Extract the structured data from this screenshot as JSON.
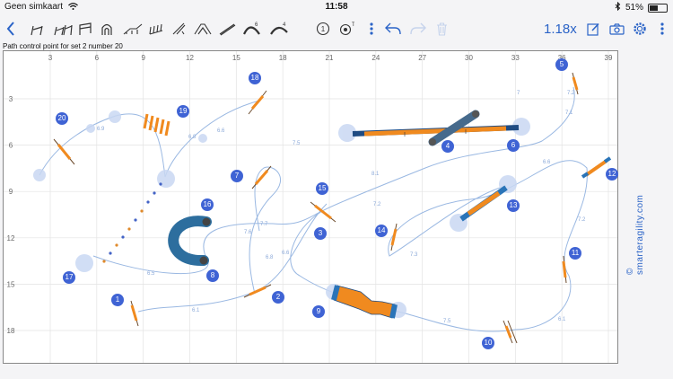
{
  "status": {
    "carrier": "Geen simkaart",
    "time": "11:58",
    "battery": "51%",
    "battery_level": 0.51
  },
  "toolbar": {
    "zoom": "1.18x",
    "tire_label": "6",
    "weave_label": "4",
    "number_tool_label": "1",
    "start_tool_label": "T"
  },
  "header": {
    "selection_text": "Path control point for set 2 number 20"
  },
  "course": {
    "x_ticks": [
      "3",
      "6",
      "9",
      "12",
      "15",
      "18",
      "21",
      "24",
      "27",
      "30",
      "33",
      "36",
      "39"
    ],
    "y_ticks": [
      "3",
      "6",
      "9",
      "12",
      "15",
      "18"
    ],
    "obstacle_numbers": [
      "1",
      "2",
      "3",
      "4",
      "5",
      "6",
      "7",
      "8",
      "9",
      "10",
      "11",
      "12",
      "13",
      "14",
      "15",
      "16",
      "17",
      "18",
      "19",
      "20"
    ],
    "distances": [
      "6.1",
      "6.5",
      "6.8",
      "6.6",
      "7.6",
      "7.7",
      "7.2",
      "6.1",
      "7.5",
      "7.1",
      "7.2",
      "6.6",
      "7.3",
      "7.2",
      "7.5",
      "8.1",
      "6.9",
      "6.8",
      "6.6",
      "7"
    ]
  },
  "brand": {
    "logo_text": "© smarteragility.com",
    "accent_color": "#2a63c7",
    "number_color": "#3f63d4"
  }
}
